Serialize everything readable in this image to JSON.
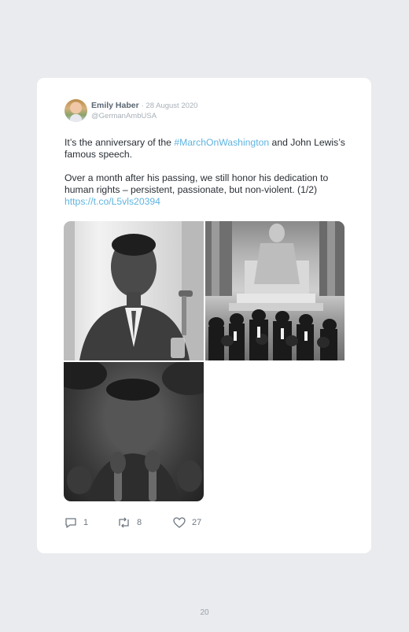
{
  "tweet": {
    "author_name": "Emily Haber",
    "date": "· 28 August 2020",
    "handle": "@GermanAmbUSA",
    "line1_a": "It’s the anniversary of the ",
    "hashtag": "#MarchOnWashington",
    "line1_b": " and John Lewis’s famous speech.",
    "para2_text": "Over a month after his passing, we still honor his dedication to human rights – persistent, passionate, but non-violent. (1/2) ",
    "link": "https://t.co/L5vls20394",
    "replies": "1",
    "retweets": "8",
    "likes": "27"
  },
  "page_number": "20",
  "icons": [
    "reply-icon",
    "retweet-icon",
    "like-icon"
  ],
  "colors": {
    "link": "#5fb4e0",
    "name": "#5a6673",
    "meta": "#a8b0b8",
    "background": "#e9ebee"
  }
}
